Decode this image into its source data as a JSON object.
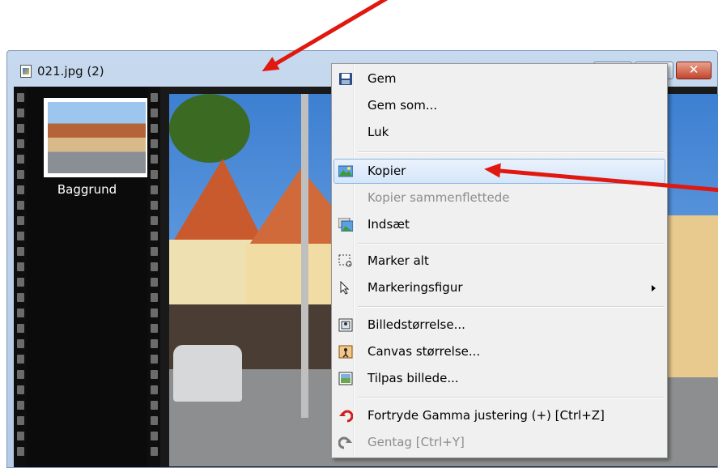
{
  "window": {
    "title": "021.jpg (2)",
    "close_glyph": "✕"
  },
  "layers_panel": {
    "layer_name": "Baggrund"
  },
  "context_menu": {
    "items": [
      {
        "label": "Gem",
        "icon": "floppy-disk-icon",
        "disabled": false
      },
      {
        "label": "Gem som...",
        "icon": "",
        "disabled": false
      },
      {
        "label": "Luk",
        "icon": "",
        "disabled": false
      },
      {
        "label": "Kopier",
        "icon": "copy-image-icon",
        "disabled": false,
        "highlighted": true
      },
      {
        "label": "Kopier sammenflettede",
        "icon": "",
        "disabled": true
      },
      {
        "label": "Indsæt",
        "icon": "paste-image-icon",
        "disabled": false
      },
      {
        "label": "Marker alt",
        "icon": "select-all-icon",
        "disabled": false
      },
      {
        "label": "Markeringsfigur",
        "icon": "cursor-arrow-icon",
        "disabled": false,
        "has_submenu": true
      },
      {
        "label": "Billedstørrelse...",
        "icon": "image-size-icon",
        "disabled": false
      },
      {
        "label": "Canvas størrelse...",
        "icon": "canvas-size-icon",
        "disabled": false
      },
      {
        "label": "Tilpas billede...",
        "icon": "fit-image-icon",
        "disabled": false
      },
      {
        "label": "Fortryde Gamma justering (+) [Ctrl+Z]",
        "icon": "undo-icon",
        "disabled": false
      },
      {
        "label": "Gentag [Ctrl+Y]",
        "icon": "redo-icon",
        "disabled": true
      }
    ]
  },
  "colors": {
    "annotation_arrow": "#e0180f",
    "menu_highlight": "#d5e6fa",
    "titlebar": "#c7d9ee"
  }
}
